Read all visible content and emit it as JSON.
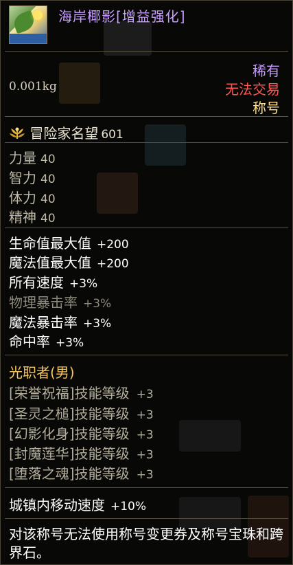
{
  "item": {
    "title": "海岸椰影[增益强化]",
    "icon": "beach-palm-title-icon",
    "rarity": "稀有",
    "trade_status": "无法交易",
    "item_type": "称号",
    "weight": "0.001kg"
  },
  "fame": {
    "label": "冒险家名望",
    "value": "601",
    "icon": "laurel-wreath-icon"
  },
  "base_stats": [
    {
      "label": "力量",
      "value": "40"
    },
    {
      "label": "智力",
      "value": "40"
    },
    {
      "label": "体力",
      "value": "40"
    },
    {
      "label": "精神",
      "value": "40"
    }
  ],
  "bonuses": [
    {
      "label": "生命值最大值",
      "value": "+200"
    },
    {
      "label": "魔法值最大值",
      "value": "+200"
    },
    {
      "label": "所有速度",
      "value": "+3%"
    },
    {
      "label": "物理暴击率",
      "value": "+3%"
    },
    {
      "label": "魔法暴击率",
      "value": "+3%"
    },
    {
      "label": "命中率",
      "value": "+3%"
    }
  ],
  "job": "光职者(男)",
  "skills": [
    {
      "label": "[荣誉祝福]技能等级",
      "value": "+3"
    },
    {
      "label": "[圣灵之槌]技能等级",
      "value": "+3"
    },
    {
      "label": "[幻影化身]技能等级",
      "value": "+3"
    },
    {
      "label": "[封魔莲华]技能等级",
      "value": "+3"
    },
    {
      "label": "[堕落之魂]技能等级",
      "value": "+3"
    }
  ],
  "town_move": {
    "label": "城镇内移动速度",
    "value": "+10%"
  },
  "description": "对该称号无法使用称号变更券及称号宝珠和跨界石。",
  "colors": {
    "title": "#c79dff",
    "rarity": "#c79dff",
    "trade": "#ff5454",
    "type": "#ffdf8a",
    "job": "#f5c45a",
    "dim": "#8c887b"
  }
}
